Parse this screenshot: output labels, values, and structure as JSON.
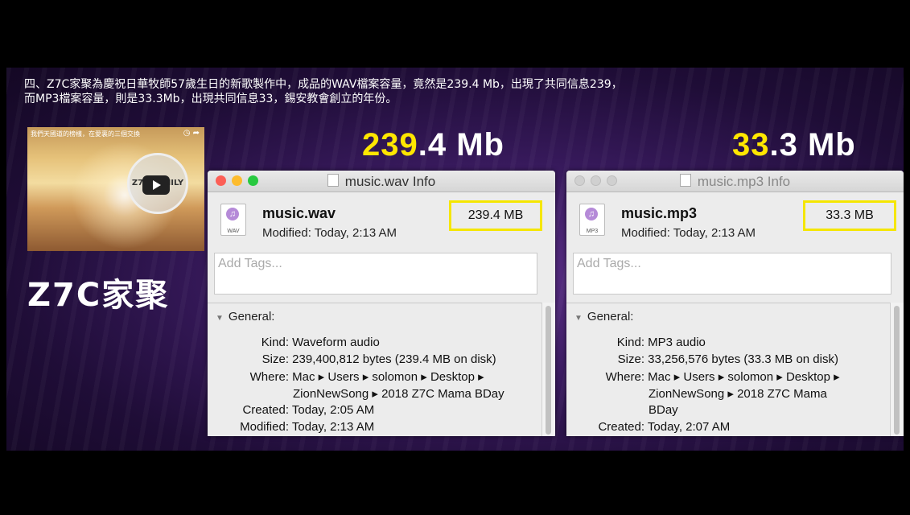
{
  "caption": {
    "line1": "四、Z7C家聚為慶祝日華牧師57歲生日的新歌製作中，成品的WAV檔案容量，竟然是239.4 Mb，出現了共同信息239，",
    "line2": "而MP3檔案容量，則是33.3Mb，出現共同信息33，錫安教會創立的年份。"
  },
  "headline_left": {
    "hl": "239",
    "rest": ".4 Mb"
  },
  "headline_right": {
    "hl": "33",
    "rest": ".3 Mb"
  },
  "video": {
    "title": "我們天國道的榜樣，在愛裏的三個交換",
    "icons": "◷ ➦",
    "logo": "Z7C FAMILY"
  },
  "brand": "Z7C家聚",
  "left_window": {
    "title": "music.wav Info",
    "file_name": "music.wav",
    "ext": "WAV",
    "modified": "Modified: Today, 2:13 AM",
    "size_badge": "239.4 MB",
    "tags_placeholder": "Add Tags...",
    "section": "General:",
    "kind_label": "Kind:",
    "kind_value": "Waveform audio",
    "size_label": "Size:",
    "size_value": "239,400,812 bytes (239.4 MB on disk)",
    "where_label": "Where:",
    "where_value_1": "Mac ▸ Users ▸ solomon ▸ Desktop ▸",
    "where_value_2": "ZionNewSong ▸ 2018 Z7C Mama BDay",
    "created_label": "Created:",
    "created_value": "Today, 2:05 AM",
    "modified_label": "Modified:",
    "modified_value": "Today, 2:13 AM"
  },
  "right_window": {
    "title": "music.mp3 Info",
    "file_name": "music.mp3",
    "ext": "MP3",
    "modified": "Modified: Today, 2:13 AM",
    "size_badge": "33.3 MB",
    "tags_placeholder": "Add Tags...",
    "section": "General:",
    "kind_label": "Kind:",
    "kind_value": "MP3 audio",
    "size_label": "Size:",
    "size_value": "33,256,576 bytes (33.3 MB on disk)",
    "where_label": "Where:",
    "where_value_1": "Mac ▸ Users ▸ solomon ▸ Desktop ▸",
    "where_value_2": "ZionNewSong ▸ 2018 Z7C Mama",
    "where_value_3": "BDay",
    "created_label": "Created:",
    "created_value": "Today, 2:07 AM"
  },
  "colors": {
    "highlight": "#ffe600",
    "badge_border": "#f5e600",
    "slide_bg": "#3a1b60"
  }
}
